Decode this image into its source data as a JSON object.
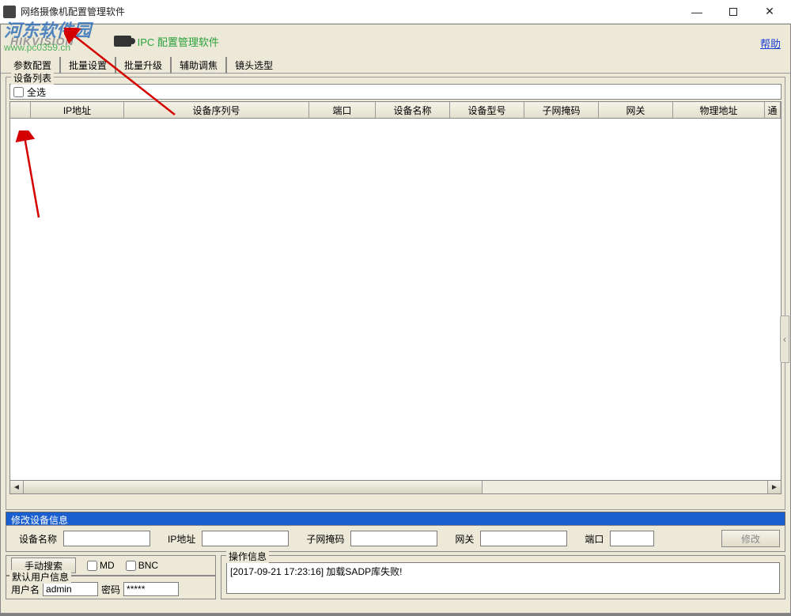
{
  "window": {
    "title": "网络摄像机配置管理软件"
  },
  "brand": {
    "logo_text": "HIKVISION",
    "product_text": "IPC 配置管理软件"
  },
  "watermark": {
    "line1": "河东软件园",
    "line2": "www.pc0359.cn"
  },
  "help": {
    "label": "帮助"
  },
  "tabs": {
    "items": [
      {
        "label": "参数配置"
      },
      {
        "label": "批量设置"
      },
      {
        "label": "批量升级"
      },
      {
        "label": "辅助调焦"
      },
      {
        "label": "镜头选型"
      }
    ]
  },
  "deviceList": {
    "group_label": "设备列表",
    "select_all_label": "全选",
    "columns": [
      "",
      "IP地址",
      "设备序列号",
      "端口",
      "设备名称",
      "设备型号",
      "子网掩码",
      "网关",
      "物理地址",
      "通"
    ]
  },
  "modify": {
    "title": "修改设备信息",
    "labels": {
      "name": "设备名称",
      "ip": "IP地址",
      "mask": "子网掩码",
      "gateway": "网关",
      "port": "端口"
    },
    "button": "修改"
  },
  "search": {
    "button": "手动搜索",
    "md_label": "MD",
    "bnc_label": "BNC"
  },
  "credentials": {
    "group_label": "默认用户信息",
    "user_label": "用户名",
    "user_value": "admin",
    "pass_label": "密码",
    "pass_value": "*****"
  },
  "opinfo": {
    "group_label": "操作信息",
    "log_line": "[2017-09-21 17:23:16] 加载SADP库失败!"
  }
}
